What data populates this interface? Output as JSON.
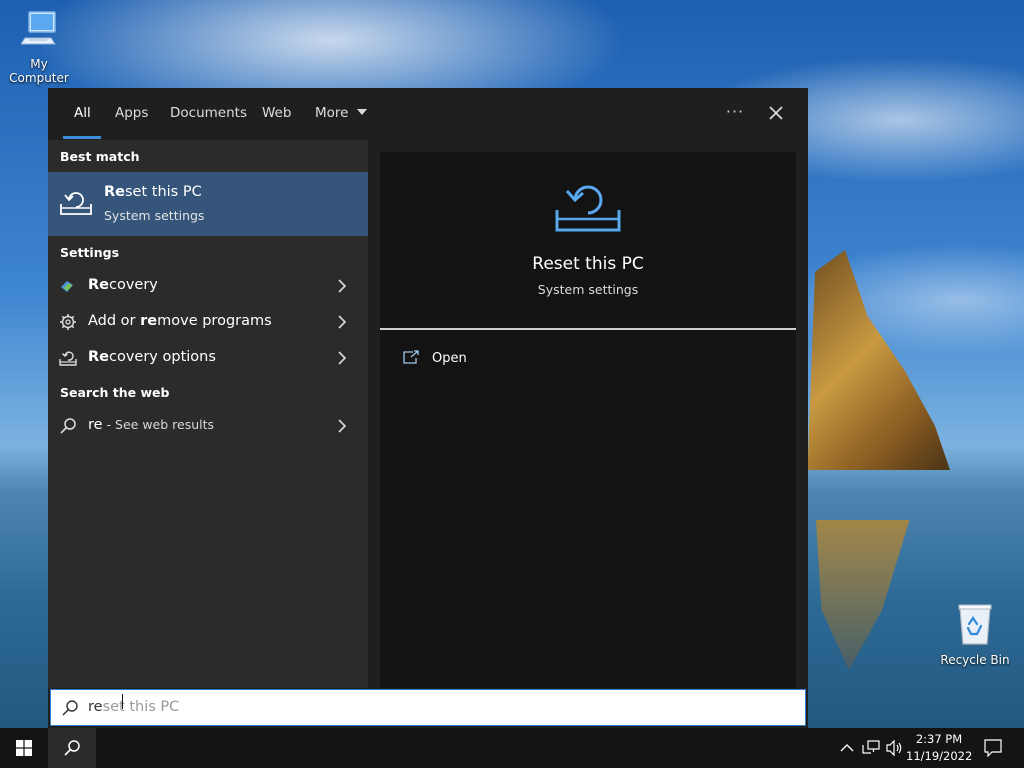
{
  "desktop": {
    "icons": [
      {
        "label": "My Computer",
        "icon": "computer-icon"
      },
      {
        "label": "Recycle Bin",
        "icon": "recycle-bin-icon"
      }
    ]
  },
  "search_panel": {
    "tabs": [
      {
        "label": "All",
        "active": true
      },
      {
        "label": "Apps"
      },
      {
        "label": "Documents"
      },
      {
        "label": "Web"
      },
      {
        "label": "More"
      }
    ],
    "more_icon": "caret-down-icon",
    "options_label": "···",
    "close_icon": "close-icon",
    "best_match": {
      "section_label": "Best match",
      "title_bold": "Re",
      "title_rest": "set this PC",
      "subtitle": "System settings",
      "icon": "reset-pc-icon"
    },
    "settings": {
      "section_label": "Settings",
      "items": [
        {
          "bold": "Re",
          "rest": "covery",
          "icon": "recovery-icon"
        },
        {
          "pre": "Add or ",
          "bold": "re",
          "rest": "move programs",
          "icon": "gear-icon"
        },
        {
          "bold": "Re",
          "rest": "covery options",
          "icon": "reset-pc-icon"
        }
      ]
    },
    "web": {
      "section_label": "Search the web",
      "query": "re",
      "suffix": " - See web results",
      "icon": "search-icon"
    },
    "preview": {
      "title": "Reset this PC",
      "subtitle": "System settings",
      "open_label": "Open",
      "icon": "reset-pc-icon"
    },
    "search_box": {
      "typed": "re",
      "ghost": "set this PC"
    }
  },
  "taskbar": {
    "time": "2:37 PM",
    "date": "11/19/2022"
  },
  "colors": {
    "accent": "#3b8fd9",
    "selected_row": "#35557a",
    "panel_dark": "#1f1f1f",
    "left_pane": "#2b2b2b",
    "right_pane": "#131313"
  }
}
